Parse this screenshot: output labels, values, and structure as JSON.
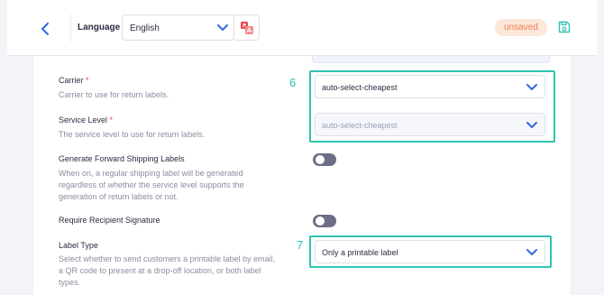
{
  "header": {
    "language_label": "Language",
    "language_value": "English",
    "status_badge": "unsaved",
    "colors": {
      "accent": "#2d6cdf",
      "badge_bg": "#fde6da",
      "badge_text": "#e8834f",
      "translate_icon": "#e5484d",
      "save_icon": "#2fc4b0"
    }
  },
  "form": {
    "carrier": {
      "label": "Carrier",
      "required_mark": "*",
      "description": "Carrier to use for return labels.",
      "value": "auto-select-cheapest"
    },
    "service_level": {
      "label": "Service Level",
      "required_mark": "*",
      "description": "The service level to use for return labels.",
      "value": "auto-select-cheapest"
    },
    "forward_labels": {
      "label": "Generate Forward Shipping Labels",
      "description": "When on, a regular shipping label will be generated regardless of whether the service level supports the generation of return labels or not.",
      "enabled": false
    },
    "signature": {
      "label": "Require Recipient Signature",
      "enabled": false
    },
    "label_type": {
      "label": "Label Type",
      "description": "Select whether to send customers a printable label by email, a QR code to present at a drop-off location, or both label types.",
      "value": "Only a printable label"
    }
  },
  "annotations": {
    "marker_6": "6",
    "marker_7": "7",
    "color": "#2fc4b0"
  },
  "icons": {
    "back": "chevron-left-icon",
    "language_dropdown": "chevron-down-icon",
    "translate": "translate-icon",
    "save": "save-icon"
  }
}
